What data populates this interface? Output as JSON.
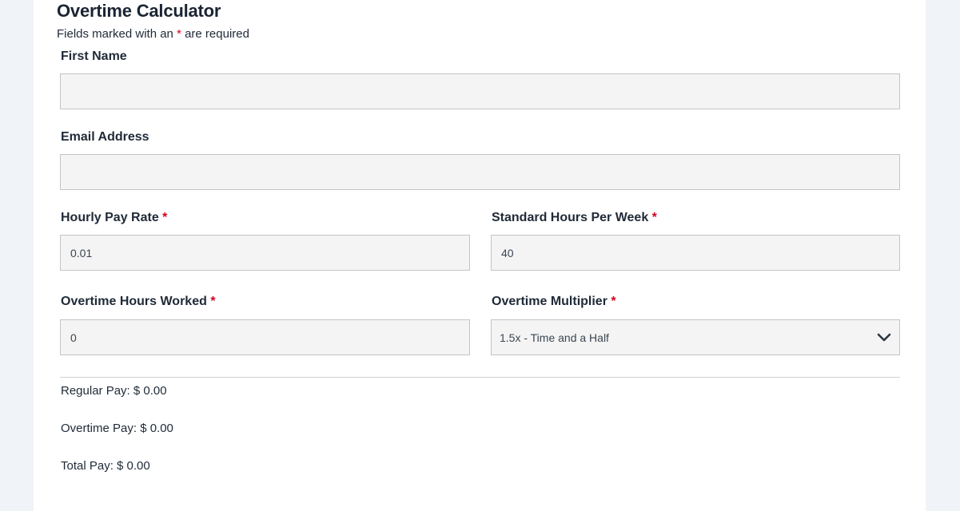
{
  "form": {
    "title": "Overtime Calculator",
    "required_note_prefix": "Fields marked with an ",
    "required_marker": "*",
    "required_note_suffix": " are required"
  },
  "fields": {
    "first_name": {
      "label": "First Name",
      "value": ""
    },
    "email": {
      "label": "Email Address",
      "value": ""
    },
    "hourly_rate": {
      "label": "Hourly Pay Rate",
      "value": "0.01"
    },
    "standard_hours": {
      "label": "Standard Hours Per Week",
      "value": "40"
    },
    "overtime_hours": {
      "label": "Overtime Hours Worked",
      "value": "0"
    },
    "multiplier": {
      "label": "Overtime Multiplier",
      "selected": "1.5x - Time and a Half"
    }
  },
  "results": {
    "regular_pay": "Regular Pay: $ 0.00",
    "overtime_pay": "Overtime Pay: $ 0.00",
    "total_pay": "Total Pay: $ 0.00"
  },
  "colors": {
    "required": "#d0021b",
    "input_background": "#f4f4f4",
    "input_border": "#c4c4c4",
    "page_background": "#f0f4f8"
  }
}
